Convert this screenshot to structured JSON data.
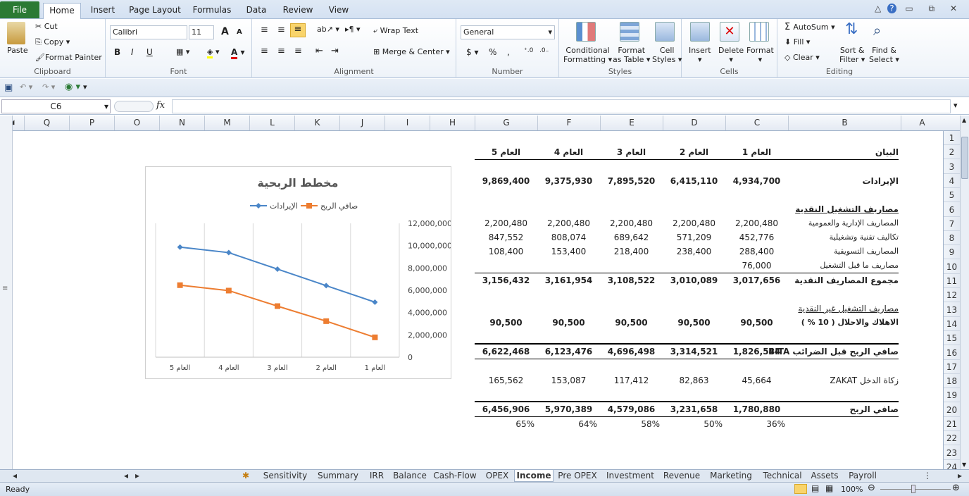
{
  "ribbon_tabs": [
    "File",
    "Home",
    "Insert",
    "Page Layout",
    "Formulas",
    "Data",
    "Review",
    "View"
  ],
  "clipboard": {
    "paste": "Paste",
    "cut": "Cut",
    "copy": "Copy",
    "format_painter": "Format Painter",
    "label": "Clipboard"
  },
  "font": {
    "name": "Calibri",
    "size": "11",
    "bold": "B",
    "italic": "I",
    "underline": "U",
    "label": "Font",
    "grow": "A",
    "shrink": "A",
    "color_letter": "A"
  },
  "alignment": {
    "wrap": "Wrap Text",
    "merge": "Merge & Center",
    "label": "Alignment"
  },
  "number": {
    "format": "General",
    "currency": "$",
    "percent": "%",
    "comma": ",",
    "label": "Number"
  },
  "styles": {
    "conditional": "Conditional",
    "conditional2": "Formatting",
    "format_table": "Format",
    "format_table2": "as Table",
    "cell_styles": "Cell",
    "cell_styles2": "Styles",
    "label": "Styles"
  },
  "cells": {
    "insert": "Insert",
    "delete": "Delete",
    "format": "Format",
    "label": "Cells"
  },
  "editing": {
    "autosum": "AutoSum",
    "fill": "Fill",
    "clear": "Clear",
    "sort": "Sort &",
    "sort2": "Filter",
    "find": "Find &",
    "find2": "Select",
    "label": "Editing"
  },
  "formula_bar": {
    "name_box": "C6",
    "fx": "fx",
    "value": ""
  },
  "columns": [
    "Q",
    "P",
    "O",
    "N",
    "M",
    "L",
    "K",
    "J",
    "I",
    "H",
    "G",
    "F",
    "E",
    "D",
    "C",
    "B",
    "A"
  ],
  "rows": [
    "1",
    "2",
    "3",
    "4",
    "5",
    "6",
    "7",
    "8",
    "9",
    "10",
    "11",
    "12",
    "13",
    "14",
    "15",
    "16",
    "17",
    "18",
    "19",
    "20",
    "21",
    "22",
    "23",
    "24"
  ],
  "table": {
    "header": {
      "label": "البيان",
      "years": [
        "العام 1",
        "العام 2",
        "العام 3",
        "العام 4",
        "العام 5"
      ]
    },
    "revenue": {
      "label": "الإيرادات",
      "values": [
        "4,934,700",
        "6,415,110",
        "7,895,520",
        "9,375,930",
        "9,869,400"
      ]
    },
    "opex_title": "مصاريف التشغيل النقدية",
    "admin": {
      "label": "المصاريف الإدارية والعمومية",
      "values": [
        "2,200,480",
        "2,200,480",
        "2,200,480",
        "2,200,480",
        "2,200,480"
      ]
    },
    "tech": {
      "label": "تكاليف تقنية وتشغيلية",
      "values": [
        "452,776",
        "571,209",
        "689,642",
        "808,074",
        "847,552"
      ]
    },
    "marketing": {
      "label": "المصاريف التسويقية",
      "values": [
        "288,400",
        "238,400",
        "218,400",
        "153,400",
        "108,400"
      ]
    },
    "preop": {
      "label": "مصاريف ما قبل التشغيل",
      "values": [
        "76,000",
        "",
        "",
        "",
        ""
      ]
    },
    "total_opex": {
      "label": "مجموع المصاريف النقدية",
      "values": [
        "3,017,656",
        "3,010,089",
        "3,108,522",
        "3,161,954",
        "3,156,432"
      ]
    },
    "noncash_title": "مصاريف التشغيل غير النقدية",
    "depr": {
      "label": "الاهلاك والاحلال ( 10 % )",
      "values": [
        "90,500",
        "90,500",
        "90,500",
        "90,500",
        "90,500"
      ]
    },
    "ebita": {
      "label": "صافي الربح قبل الضرائب BITA",
      "values": [
        "1,826,544",
        "3,314,521",
        "4,696,498",
        "6,123,476",
        "6,622,468"
      ]
    },
    "zakat": {
      "label": "زكاة الدخل ZAKAT",
      "values": [
        "45,664",
        "82,863",
        "117,412",
        "153,087",
        "165,562"
      ]
    },
    "net": {
      "label": "صافي الربح",
      "values": [
        "1,780,880",
        "3,231,658",
        "4,579,086",
        "5,970,389",
        "6,456,906"
      ]
    },
    "margin": {
      "values": [
        "36%",
        "50%",
        "58%",
        "64%",
        "65%"
      ]
    }
  },
  "chart_data": {
    "type": "line",
    "title": "مخطط الربحية",
    "categories": [
      "العام 1",
      "العام 2",
      "العام 3",
      "العام 4",
      "العام 5"
    ],
    "series": [
      {
        "name": "الإيرادات",
        "color": "#4a86c8",
        "values": [
          4934700,
          6415110,
          7895520,
          9375930,
          9869400
        ]
      },
      {
        "name": "صافي الربح",
        "color": "#ed7d31",
        "values": [
          1780880,
          3231658,
          4579086,
          5970389,
          6456906
        ]
      }
    ],
    "y_ticks": [
      "0",
      "2,000,000",
      "4,000,000",
      "6,000,000",
      "8,000,000",
      "10,000,000",
      "12,000,000"
    ],
    "ylim": [
      0,
      12000000
    ],
    "x_reversed": true,
    "y_axis_side": "right",
    "legend": "top",
    "grid": "vertical"
  },
  "sheet_tabs": [
    "Sensitivity",
    "Summary",
    "IRR",
    "Balance",
    "Cash-Flow",
    "OPEX",
    "Income",
    "Pre OPEX",
    "Investment",
    "Revenue",
    "Marketing",
    "Technical",
    "Assets",
    "Payroll"
  ],
  "active_sheet": "Income",
  "status": {
    "ready": "Ready",
    "zoom": "100%"
  },
  "colors": {
    "file_tab": "#2b7a34",
    "revenue_line": "#4a86c8",
    "profit_line": "#ed7d31"
  }
}
